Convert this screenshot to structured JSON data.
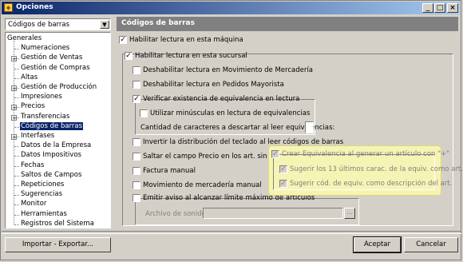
{
  "window": {
    "title": "Opciones"
  },
  "nav": {
    "selected_option": "Códigos de barras",
    "tree": [
      {
        "label": "Generales",
        "depth": 0,
        "expander": false
      },
      {
        "label": "Numeraciones",
        "depth": 1,
        "expander": false
      },
      {
        "label": "Gestión de Ventas",
        "depth": 1,
        "expander": true
      },
      {
        "label": "Gestión de Compras",
        "depth": 1,
        "expander": false
      },
      {
        "label": "Altas",
        "depth": 1,
        "expander": false
      },
      {
        "label": "Gestión de Producción",
        "depth": 1,
        "expander": true
      },
      {
        "label": "Impresiones",
        "depth": 1,
        "expander": false
      },
      {
        "label": "Precios",
        "depth": 1,
        "expander": true
      },
      {
        "label": "Transferencias",
        "depth": 1,
        "expander": true
      },
      {
        "label": "Códigos de barras",
        "depth": 1,
        "expander": false,
        "selected": true
      },
      {
        "label": "Interfases",
        "depth": 1,
        "expander": true
      },
      {
        "label": "Datos de la Empresa",
        "depth": 1,
        "expander": false
      },
      {
        "label": "Datos Impositivos",
        "depth": 1,
        "expander": false
      },
      {
        "label": "Fechas",
        "depth": 1,
        "expander": false
      },
      {
        "label": "Saltos de Campos",
        "depth": 1,
        "expander": false
      },
      {
        "label": "Repeticiones",
        "depth": 1,
        "expander": false
      },
      {
        "label": "Sugerencias",
        "depth": 1,
        "expander": false
      },
      {
        "label": "Monitor",
        "depth": 1,
        "expander": false
      },
      {
        "label": "Herramientas",
        "depth": 1,
        "expander": false
      },
      {
        "label": "Registros del Sistema",
        "depth": 1,
        "expander": false
      }
    ]
  },
  "panel": {
    "title": "Códigos de barras",
    "habilitar_maquina": {
      "label": "Habilitar lectura en esta máquina",
      "checked": true
    },
    "habilitar_sucursal": {
      "label": "Habilitar lectura en esta sucursal",
      "checked": true
    },
    "deshab_mov_mercaderia": {
      "label": "Deshabilitar lectura en Movimiento de Mercadería",
      "checked": false
    },
    "deshab_pedidos": {
      "label": "Deshabilitar lectura en Pedidos Mayorista",
      "checked": false
    },
    "verificar_equivalencia": {
      "label": "Verificar existencia de equivalencia en lectura",
      "checked": true
    },
    "minusculas": {
      "label": "Utilizar minúsculas en lectura de equivalencias",
      "checked": false
    },
    "cantidad_label": "Cantidad de caracteres a descartar al leer equivalencias:",
    "cantidad_value": "",
    "invertir": {
      "label": "Invertir la distribución del teclado al leer códigos de barras",
      "checked": false
    },
    "saltar_precio": {
      "label": "Saltar el campo Precio en los art. sin precio",
      "checked": false
    },
    "factura_manual": {
      "label": "Factura manual",
      "checked": false
    },
    "mov_manual": {
      "label": "Movimiento de mercadería manual",
      "checked": false
    },
    "crear_equivalencia": {
      "label": "Crear Equivalencia al generar un artículo con \"+\"",
      "checked": true
    },
    "sugerir_13": {
      "label": "Sugerir los 13 últimos carac. de la equiv. como art.",
      "checked": true
    },
    "sugerir_desc": {
      "label": "Sugerir cód. de equiv. como descripción del art.",
      "checked": true
    },
    "emitir_aviso": {
      "label": "Emitir aviso al alcanzar límite máximo de artículos",
      "checked": false
    },
    "archivo_label": "Archivo de sonido:",
    "archivo_value": "",
    "browse_label": "..."
  },
  "footer": {
    "importar_label": "Importar - Exportar...",
    "aceptar_label": "Aceptar",
    "cancelar_label": "Cancelar"
  },
  "icons": {
    "app": "options-app-icon",
    "minimize": "minimize-icon",
    "maximize": "maximize-icon",
    "close": "close-icon",
    "dropdown": "chevron-down-icon"
  }
}
